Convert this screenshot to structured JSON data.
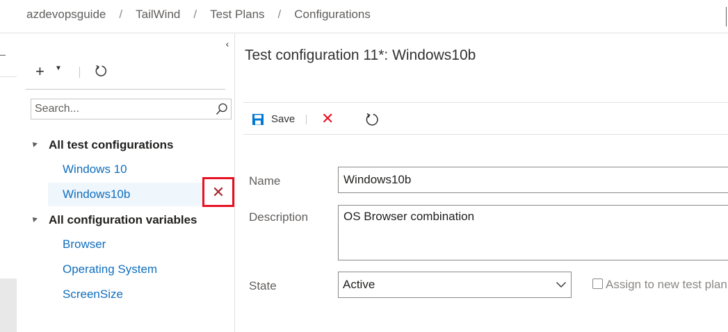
{
  "breadcrumb": [
    "azdevopsguide",
    "TailWind",
    "Test Plans",
    "Configurations"
  ],
  "breadcrumb_separator": "/",
  "tree": {
    "collapse_icon": "‹",
    "search_placeholder": "Search...",
    "groups": [
      {
        "label": "All test configurations",
        "items": [
          "Windows 10",
          "Windows10b"
        ]
      },
      {
        "label": "All configuration variables",
        "items": [
          "Browser",
          "Operating System",
          "ScreenSize"
        ]
      }
    ],
    "selected_item": "Windows10b",
    "delete_icon": "✕"
  },
  "content": {
    "title": "Test configuration 11*: Windows10b",
    "toolbar": {
      "save_label": "Save"
    },
    "fields": {
      "name_label": "Name",
      "name_value": "Windows10b",
      "description_label": "Description",
      "description_value": "OS Browser combination",
      "state_label": "State",
      "state_value": "Active",
      "assign_label": "Assign to new test plan"
    }
  },
  "colors": {
    "link": "#106ebe",
    "accent_save": "#0078d4",
    "danger": "#e81123",
    "selected_bg": "#eff6fc"
  }
}
